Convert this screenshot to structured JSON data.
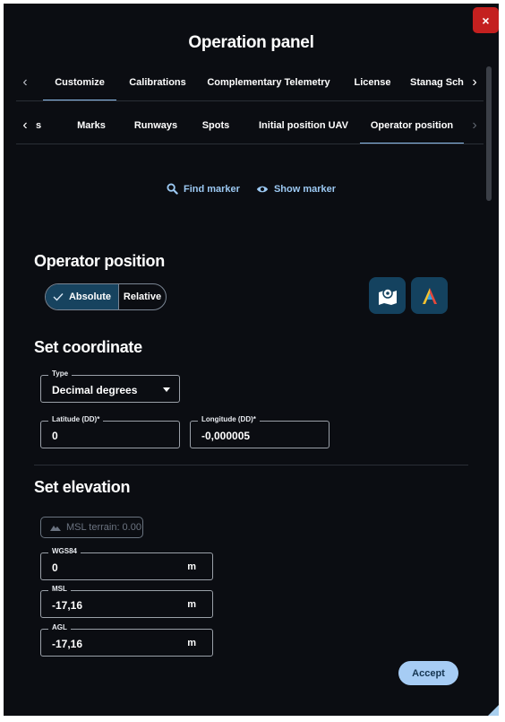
{
  "panel": {
    "title": "Operation panel",
    "close_label": "×"
  },
  "tabs_row1": {
    "prev_icon": "‹",
    "next_icon": "›",
    "items": [
      {
        "label": "Customize"
      },
      {
        "label": "Calibrations"
      },
      {
        "label": "Complementary Telemetry"
      },
      {
        "label": "License"
      },
      {
        "label": "Stanag Sch"
      }
    ],
    "active": "Customize"
  },
  "tabs_row2": {
    "prev_icon": "‹",
    "next_icon": "›",
    "items": [
      {
        "label": "s"
      },
      {
        "label": "Marks"
      },
      {
        "label": "Runways"
      },
      {
        "label": "Spots"
      },
      {
        "label": "Initial position UAV"
      },
      {
        "label": "Operator position"
      }
    ],
    "active": "Operator position"
  },
  "actions": {
    "find_marker": "Find marker",
    "show_marker": "Show marker"
  },
  "operator_position": {
    "heading": "Operator position",
    "absolute_label": "Absolute",
    "relative_label": "Relative",
    "selected": "Absolute"
  },
  "coordinate": {
    "heading": "Set coordinate",
    "type_label": "Type",
    "type_value": "Decimal degrees",
    "latitude_label": "Latitude (DD)*",
    "latitude_value": "0",
    "longitude_label": "Longitude (DD)*",
    "longitude_value": "-0,000005"
  },
  "elevation": {
    "heading": "Set elevation",
    "msl_terrain_chip": "MSL terrain: 0.00",
    "fields": [
      {
        "label": "WGS84",
        "value": "0",
        "unit": "m"
      },
      {
        "label": "MSL",
        "value": "-17,16",
        "unit": "m"
      },
      {
        "label": "AGL",
        "value": "-17,16",
        "unit": "m"
      }
    ]
  },
  "accept_label": "Accept",
  "colors": {
    "background": "#0b0d12",
    "close": "#c4201f",
    "accent": "#8ab9e8",
    "button_dark": "#14425f",
    "accept": "#a6ccf4"
  }
}
